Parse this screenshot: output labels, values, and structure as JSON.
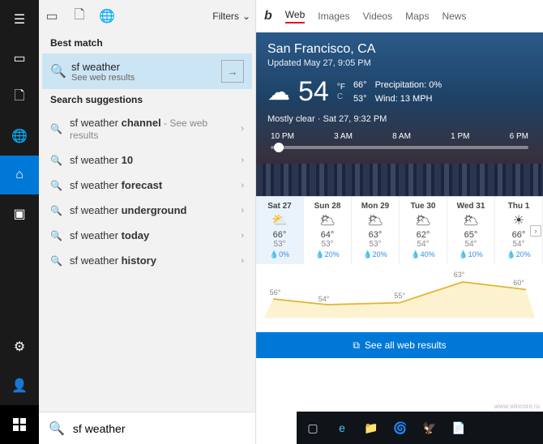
{
  "rail": {
    "home": "⌂",
    "store": "▣"
  },
  "panel": {
    "filters_label": "Filters",
    "best_header": "Best match",
    "best": {
      "title": "sf weather",
      "sub": "See web results"
    },
    "sugg_header": "Search suggestions",
    "suggestions": [
      {
        "pre": "sf weather ",
        "bold": "channel",
        "note": " - See web results"
      },
      {
        "pre": "sf weather ",
        "bold": "10",
        "note": ""
      },
      {
        "pre": "sf weather ",
        "bold": "forecast",
        "note": ""
      },
      {
        "pre": "sf weather ",
        "bold": "underground",
        "note": ""
      },
      {
        "pre": "sf weather ",
        "bold": "today",
        "note": ""
      },
      {
        "pre": "sf weather ",
        "bold": "history",
        "note": ""
      }
    ],
    "search_value": "sf weather"
  },
  "bing": {
    "logo": "b",
    "tabs": [
      "Web",
      "Images",
      "Videos",
      "Maps",
      "News"
    ],
    "active_tab": "Web"
  },
  "weather": {
    "location": "San Francisco, CA",
    "updated": "Updated May 27, 9:05 PM",
    "temp": "54",
    "unit_f": "°F",
    "unit_c": "C",
    "hi": "66°",
    "lo": "53°",
    "precip_label": "Precipitation: 0%",
    "wind_label": "Wind: 13 MPH",
    "condition": "Mostly clear · Sat 27, 9:32 PM",
    "hours": [
      "10 PM",
      "3 AM",
      "8 AM",
      "1 PM",
      "6 PM"
    ],
    "days": [
      {
        "name": "Sat 27",
        "icon": "⛅",
        "hi": "66°",
        "lo": "53°",
        "precip": "0%",
        "sel": true
      },
      {
        "name": "Sun 28",
        "icon": "🌥",
        "hi": "64°",
        "lo": "53°",
        "precip": "20%",
        "sel": false
      },
      {
        "name": "Mon 29",
        "icon": "🌥",
        "hi": "63°",
        "lo": "53°",
        "precip": "20%",
        "sel": false
      },
      {
        "name": "Tue 30",
        "icon": "🌥",
        "hi": "62°",
        "lo": "54°",
        "precip": "40%",
        "sel": false
      },
      {
        "name": "Wed 31",
        "icon": "🌥",
        "hi": "65°",
        "lo": "54°",
        "precip": "10%",
        "sel": false
      },
      {
        "name": "Thu 1",
        "icon": "☀",
        "hi": "66°",
        "lo": "54°",
        "precip": "20%",
        "sel": false
      }
    ],
    "see_all": "See all web results",
    "credit": "www.wincore.ru"
  },
  "chart_data": {
    "type": "line",
    "title": "",
    "xlabel": "",
    "ylabel": "",
    "ylim": [
      50,
      66
    ],
    "x": [
      "10 PM",
      "3 AM",
      "8 AM",
      "1 PM",
      "6 PM"
    ],
    "values": [
      56,
      54,
      55,
      63,
      60
    ],
    "labels": [
      "56°",
      "54°",
      "",
      "55°",
      "63°",
      "60°"
    ]
  }
}
